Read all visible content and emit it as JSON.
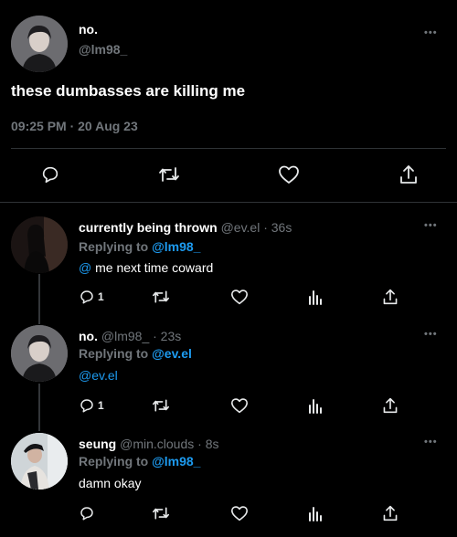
{
  "main_tweet": {
    "display_name": "no.",
    "handle": "@lm98_",
    "text": "these dumbasses are killing me",
    "timestamp": "09:25 PM · 20 Aug 23",
    "more_label": "•••"
  },
  "replies": [
    {
      "display_name": "currently being thrown",
      "handle_time": "@ev.el · 36s",
      "replying_prefix": "Replying to",
      "replying_to": "@lm98_",
      "text": "@ me next time coward",
      "reply_count": "1",
      "more_label": "•••"
    },
    {
      "display_name": "no.",
      "handle_time": "@lm98_ · 23s",
      "replying_prefix": "Replying to",
      "replying_to": "@ev.el",
      "text": "@ev.el",
      "reply_count": "1",
      "more_label": "•••"
    },
    {
      "display_name": "seung",
      "handle_time": "@min.clouds · 8s",
      "replying_prefix": "Replying to",
      "replying_to": "@lm98_",
      "text": "damn okay",
      "reply_count": "",
      "more_label": "•••"
    }
  ],
  "icons": {
    "reply": "reply-icon",
    "retweet": "retweet-icon",
    "like": "heart-icon",
    "views": "views-icon",
    "share": "share-icon",
    "more": "more-icon"
  },
  "colors": {
    "background": "#000000",
    "accent": "#1d9bf0",
    "secondary_text": "#71767b",
    "divider": "#2f3336"
  }
}
